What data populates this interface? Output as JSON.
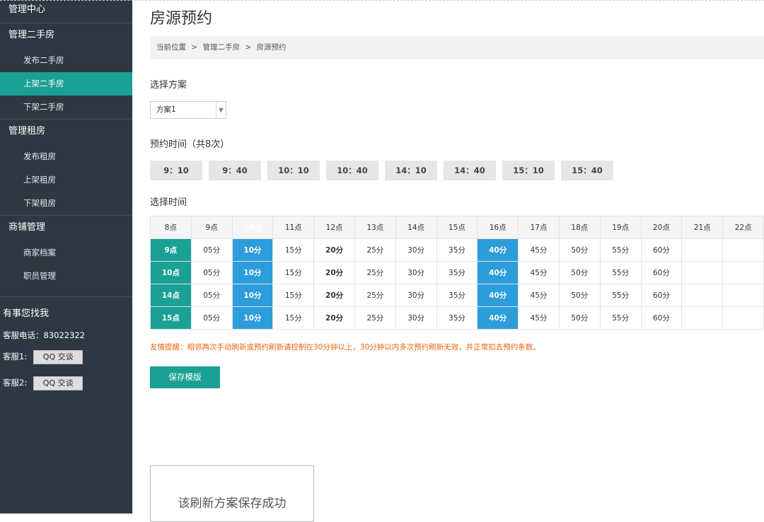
{
  "sidebar": {
    "header": "管理中心",
    "groups": [
      {
        "title": "管理二手房",
        "items": [
          "发布二手房",
          "上架二手房",
          "下架二手房"
        ]
      },
      {
        "title": "管理租房",
        "items": [
          "发布租房",
          "上架租房",
          "下架租房"
        ]
      },
      {
        "title": "商铺管理",
        "items": [
          "商家档案",
          "职员管理"
        ]
      }
    ],
    "contact": {
      "title": "有事您找我",
      "phone": "客服电话：83022322",
      "qq": [
        {
          "label": "客服1:",
          "button": "QQ 交谈"
        },
        {
          "label": "客服2:",
          "button": "QQ 交谈"
        }
      ]
    }
  },
  "page": {
    "title": "房源预约",
    "breadcrumb": [
      "当前位置",
      "管理二手房",
      "房源预约"
    ],
    "breadcrumb_sep": ">",
    "plan_label": "选择方案",
    "plan_selected": "方案1",
    "times_label": "预约时间（共8次）",
    "times": [
      "9：10",
      "9：40",
      "10：10",
      "10：40",
      "14：10",
      "14：40",
      "15：10",
      "15：40"
    ],
    "grid_label": "选择时间",
    "hours": [
      "8点",
      "9点",
      "10点",
      "11点",
      "12点",
      "13点",
      "14点",
      "15点",
      "16点",
      "17点",
      "18点",
      "19点",
      "20点",
      "21点",
      "22点"
    ],
    "minutes": [
      "05分",
      "10分",
      "15分",
      "20分",
      "25分",
      "30分",
      "35分",
      "40分",
      "45分",
      "50分",
      "55分",
      "60分"
    ],
    "rows": [
      "9点",
      "10点",
      "14点",
      "15点"
    ],
    "notice": "友情提醒：相邻两次手动刷新或预约刷新请控制在30分钟以上，30分钟以内多次预约刷新无效，并正常扣去预约条数。",
    "save_button": "保存模版",
    "toast": "该刷新方案保存成功"
  }
}
